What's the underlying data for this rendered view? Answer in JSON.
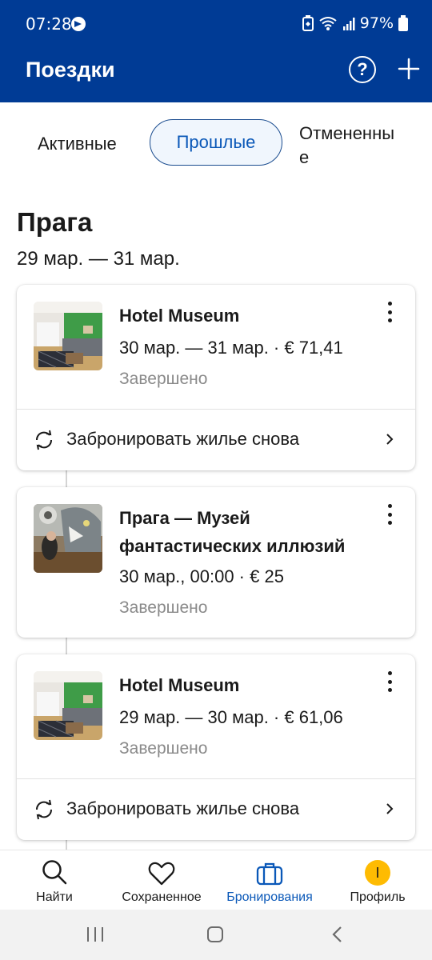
{
  "status_bar": {
    "time": "07:28",
    "battery": "97%"
  },
  "app_bar": {
    "title": "Поездки",
    "help_icon": "help-circle-icon",
    "add_icon": "plus-icon"
  },
  "tabs": [
    {
      "label": "Активные",
      "active": false
    },
    {
      "label": "Прошлые",
      "active": true
    },
    {
      "label": "Отмененные",
      "active": false
    }
  ],
  "trip": {
    "city": "Прага",
    "dates": "29 мар. — 31 мар.",
    "bookings": [
      {
        "title": "Hotel Museum",
        "meta": "30 мар. — 31 мар. · € 71,41",
        "status": "Завершено",
        "rebook_label": "Забронировать жилье снова",
        "image": "hotel-room-photo"
      },
      {
        "title_line1": "Прага — Музей",
        "title_line2": "фантастических иллюзий",
        "meta": "30 мар., 00:00 · € 25",
        "status": "Завершено",
        "image": "illusion-museum-photo"
      },
      {
        "title": "Hotel Museum",
        "meta": "29 мар. — 30 мар. · € 61,06",
        "status": "Завершено",
        "rebook_label": "Забронировать жилье снова",
        "image": "hotel-room-photo"
      }
    ]
  },
  "bottom_nav": [
    {
      "label": "Найти",
      "icon": "search-icon",
      "active": false
    },
    {
      "label": "Сохраненное",
      "icon": "heart-icon",
      "active": false
    },
    {
      "label": "Бронирования",
      "icon": "suitcase-icon",
      "active": true
    },
    {
      "label": "Профиль",
      "icon": "avatar-icon",
      "active": false,
      "avatar_letter": "I"
    }
  ],
  "colors": {
    "brand": "#003b95",
    "accent": "#0a58b8",
    "avatar": "#febb02",
    "muted": "#8a8a8a"
  }
}
